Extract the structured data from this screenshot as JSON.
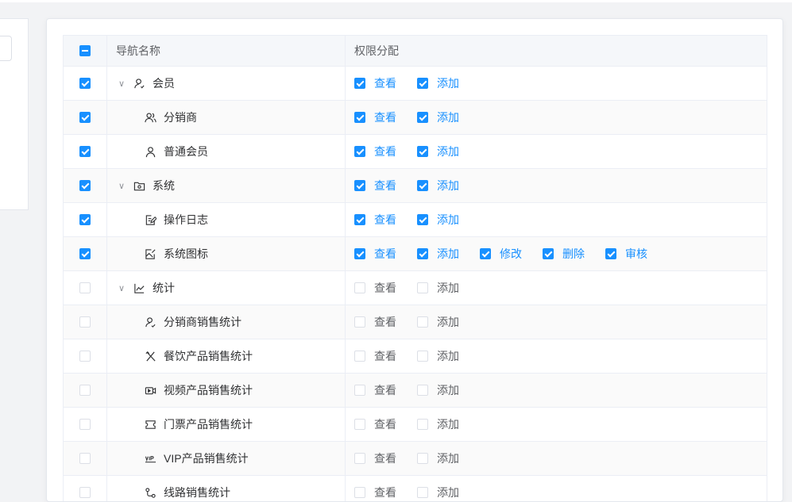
{
  "table": {
    "header": {
      "name": "导航名称",
      "perm": "权限分配",
      "select_state": "indeterminate"
    },
    "rows": [
      {
        "name": "会员",
        "level": 0,
        "expandable": true,
        "icon": "user-icon",
        "checked": true,
        "perms": [
          {
            "label": "查看",
            "checked": true
          },
          {
            "label": "添加",
            "checked": true
          }
        ]
      },
      {
        "name": "分销商",
        "level": 1,
        "expandable": false,
        "icon": "users-icon",
        "checked": true,
        "perms": [
          {
            "label": "查看",
            "checked": true
          },
          {
            "label": "添加",
            "checked": true
          }
        ]
      },
      {
        "name": "普通会员",
        "level": 1,
        "expandable": false,
        "icon": "person-icon",
        "checked": true,
        "perms": [
          {
            "label": "查看",
            "checked": true
          },
          {
            "label": "添加",
            "checked": true
          }
        ]
      },
      {
        "name": "系统",
        "level": 0,
        "expandable": true,
        "icon": "folder-gear-icon",
        "checked": true,
        "perms": [
          {
            "label": "查看",
            "checked": true
          },
          {
            "label": "添加",
            "checked": true
          }
        ]
      },
      {
        "name": "操作日志",
        "level": 1,
        "expandable": false,
        "icon": "edit-document-icon",
        "checked": true,
        "perms": [
          {
            "label": "查看",
            "checked": true
          },
          {
            "label": "添加",
            "checked": true
          }
        ]
      },
      {
        "name": "系统图标",
        "level": 1,
        "expandable": false,
        "icon": "image-edit-icon",
        "checked": true,
        "perms": [
          {
            "label": "查看",
            "checked": true
          },
          {
            "label": "添加",
            "checked": true
          },
          {
            "label": "修改",
            "checked": true
          },
          {
            "label": "删除",
            "checked": true
          },
          {
            "label": "审核",
            "checked": true
          }
        ]
      },
      {
        "name": "统计",
        "level": 0,
        "expandable": true,
        "icon": "line-chart-icon",
        "checked": false,
        "perms": [
          {
            "label": "查看",
            "checked": false
          },
          {
            "label": "添加",
            "checked": false
          }
        ]
      },
      {
        "name": "分销商销售统计",
        "level": 1,
        "expandable": false,
        "icon": "user-check-icon",
        "checked": false,
        "perms": [
          {
            "label": "查看",
            "checked": false
          },
          {
            "label": "添加",
            "checked": false
          }
        ]
      },
      {
        "name": "餐饮产品销售统计",
        "level": 1,
        "expandable": false,
        "icon": "fork-knife-icon",
        "checked": false,
        "perms": [
          {
            "label": "查看",
            "checked": false
          },
          {
            "label": "添加",
            "checked": false
          }
        ]
      },
      {
        "name": "视频产品销售统计",
        "level": 1,
        "expandable": false,
        "icon": "video-icon",
        "checked": false,
        "perms": [
          {
            "label": "查看",
            "checked": false
          },
          {
            "label": "添加",
            "checked": false
          }
        ]
      },
      {
        "name": "门票产品销售统计",
        "level": 1,
        "expandable": false,
        "icon": "ticket-icon",
        "checked": false,
        "perms": [
          {
            "label": "查看",
            "checked": false
          },
          {
            "label": "添加",
            "checked": false
          }
        ]
      },
      {
        "name": "VIP产品销售统计",
        "level": 1,
        "expandable": false,
        "icon": "vip-icon",
        "checked": false,
        "perms": [
          {
            "label": "查看",
            "checked": false
          },
          {
            "label": "添加",
            "checked": false
          }
        ]
      },
      {
        "name": "线路销售统计",
        "level": 1,
        "expandable": false,
        "icon": "route-icon",
        "checked": false,
        "perms": [
          {
            "label": "查看",
            "checked": false
          },
          {
            "label": "添加",
            "checked": false
          }
        ]
      }
    ]
  },
  "colors": {
    "accent": "#1890ff",
    "border": "#ebeef5",
    "header_bg": "#f5f7fa"
  }
}
